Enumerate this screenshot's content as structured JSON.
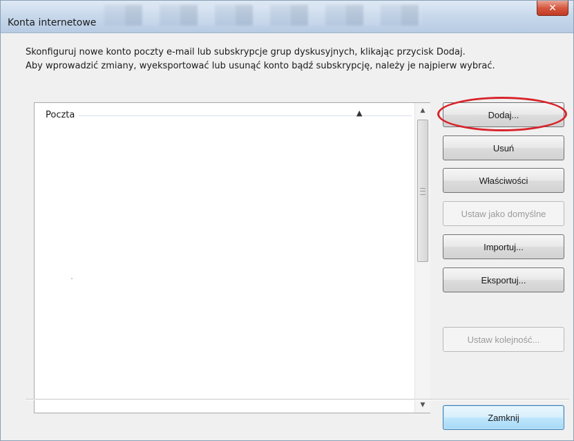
{
  "window": {
    "title": "Konta internetowe",
    "close_symbol": "✕"
  },
  "description": {
    "line1": "Skonfiguruj nowe konto poczty e-mail lub subskrypcje grup dyskusyjnych, klikając przycisk Dodaj.",
    "line2": "Aby wprowadzić zmiany, wyeksportować lub usunąć konto bądź subskrypcję, należy je najpierw wybrać."
  },
  "list": {
    "group_label": "Poczta"
  },
  "buttons": {
    "add": "Dodaj...",
    "remove": "Usuń",
    "properties": "Właściwości",
    "set_default": "Ustaw jako domyślne",
    "import": "Importuj...",
    "export": "Eksportuj...",
    "set_order": "Ustaw kolejność...",
    "close": "Zamknij"
  },
  "colors": {
    "highlight_ring": "#d8232a",
    "close_button": "#c23a22"
  }
}
